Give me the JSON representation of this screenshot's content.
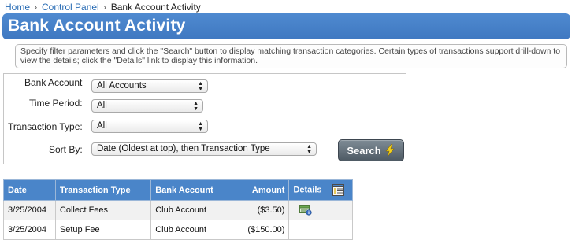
{
  "breadcrumb": {
    "home": "Home",
    "control_panel": "Control Panel",
    "current": "Bank Account Activity",
    "separator": "›"
  },
  "page": {
    "title": "Bank Account Activity",
    "help_text": "Specify filter parameters and click the \"Search\" button to display matching transaction categories. Certain types of transactions support drill-down to view the details; click the \"Details\" link to display this information."
  },
  "filters": {
    "bank_account": {
      "label": "Bank Account",
      "value": "All Accounts"
    },
    "time_period": {
      "label": "Time Period:",
      "value": "All"
    },
    "transaction_type": {
      "label": "Transaction Type:",
      "value": "All"
    },
    "sort_by": {
      "label": "Sort By:",
      "value": "Date (Oldest at top), then Transaction Type"
    },
    "search_label": "Search"
  },
  "table": {
    "columns": [
      "Date",
      "Transaction Type",
      "Bank Account",
      "Amount",
      "Details"
    ],
    "rows": [
      {
        "date": "3/25/2004",
        "type": "Collect Fees",
        "account": "Club Account",
        "amount": "($3.50)",
        "has_details": true
      },
      {
        "date": "3/25/2004",
        "type": "Setup Fee",
        "account": "Club Account",
        "amount": "($150.00)",
        "has_details": false
      }
    ]
  },
  "colors": {
    "accent": "#3f78c1",
    "header_bg": "#4a85c9",
    "link": "#2a6db5"
  },
  "icons": {
    "search_button": "lightning-bolt-icon",
    "details_header": "report-icon",
    "row_details": "details-view-icon"
  }
}
